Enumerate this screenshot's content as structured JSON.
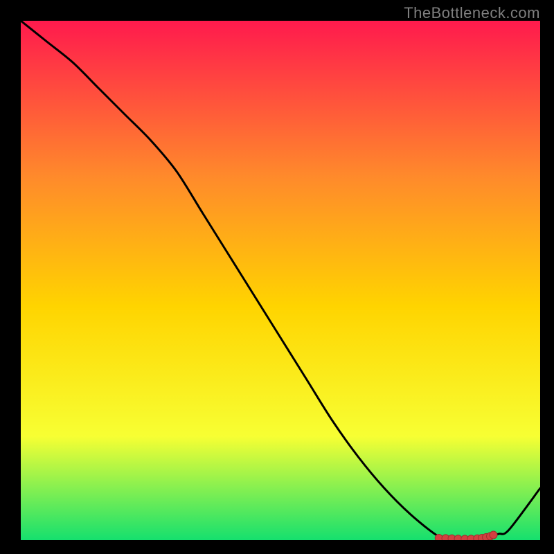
{
  "watermark": "TheBottleneck.com",
  "colors": {
    "background": "#000000",
    "gradient_top": "#ff1a4d",
    "gradient_upper_mid": "#ff8a2b",
    "gradient_mid": "#ffd400",
    "gradient_lower_mid": "#f7ff33",
    "gradient_bottom": "#15e06e",
    "line": "#000000",
    "marker_fill": "#d24040",
    "marker_stroke": "#a02e2e"
  },
  "chart_data": {
    "type": "line",
    "title": "",
    "xlabel": "",
    "ylabel": "",
    "xlim": [
      0,
      100
    ],
    "ylim": [
      0,
      100
    ],
    "series": [
      {
        "name": "curve",
        "x": [
          0,
          5,
          10,
          15,
          20,
          25,
          30,
          35,
          40,
          45,
          50,
          55,
          60,
          65,
          70,
          75,
          80,
          82,
          84,
          86,
          88,
          90,
          92,
          94,
          100
        ],
        "y": [
          100,
          96,
          92,
          87,
          82,
          77,
          71,
          63,
          55,
          47,
          39,
          31,
          23,
          16,
          10,
          5,
          1,
          0.5,
          0.3,
          0.2,
          0.3,
          0.6,
          1.2,
          2,
          10
        ]
      }
    ],
    "markers": {
      "name": "bottom-cluster",
      "x": [
        80.5,
        81.8,
        83.0,
        84.2,
        85.5,
        86.7,
        87.9,
        88.8,
        89.6,
        90.4,
        91.0
      ],
      "y": [
        0.4,
        0.35,
        0.3,
        0.25,
        0.22,
        0.24,
        0.3,
        0.4,
        0.55,
        0.75,
        1.0
      ]
    }
  }
}
